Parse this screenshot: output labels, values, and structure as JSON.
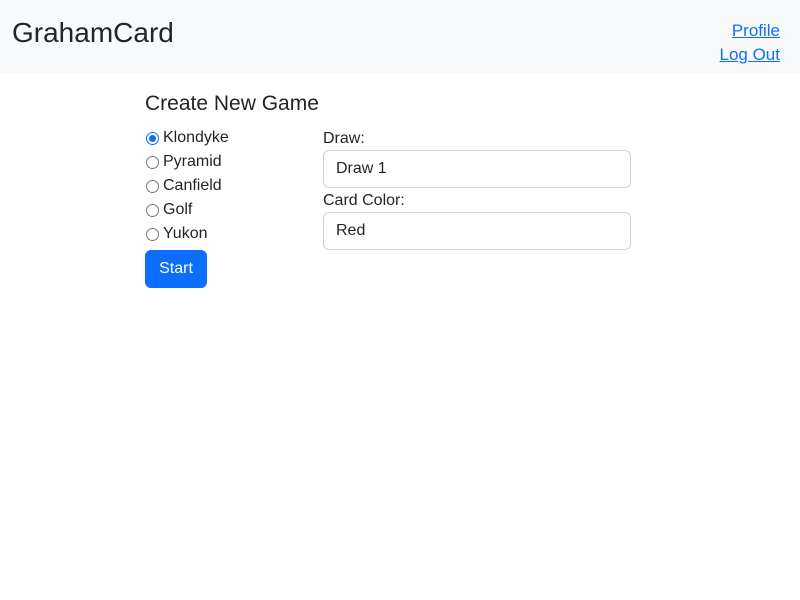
{
  "header": {
    "brand": "GrahamCard",
    "links": [
      "Profile",
      "Log Out"
    ]
  },
  "form": {
    "title": "Create New Game",
    "game_types": [
      {
        "label": "Klondyke",
        "checked": true
      },
      {
        "label": "Pyramid",
        "checked": false
      },
      {
        "label": "Canfield",
        "checked": false
      },
      {
        "label": "Golf",
        "checked": false
      },
      {
        "label": "Yukon",
        "checked": false
      }
    ],
    "start_label": "Start",
    "draw_label": "Draw:",
    "draw_value": "Draw 1",
    "color_label": "Card Color:",
    "color_value": "Red"
  },
  "colors": {
    "accent": "#0d6efd",
    "navbar_bg": "#f8f9fa"
  }
}
